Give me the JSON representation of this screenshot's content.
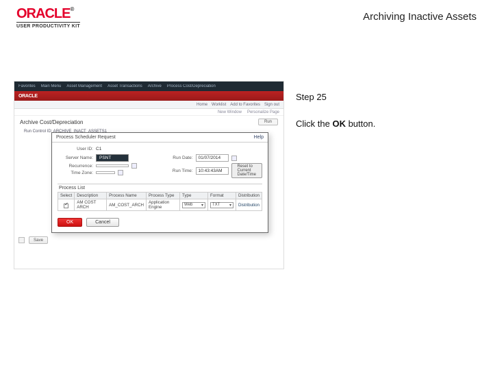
{
  "header": {
    "logo_text": "ORACLE",
    "logo_tm": "®",
    "subline": "USER PRODUCTIVITY KIT",
    "page_title": "Archiving Inactive Assets"
  },
  "instructions": {
    "step_label": "Step 25",
    "body_pre": "Click the ",
    "body_bold": "OK",
    "body_post": " button."
  },
  "screenshot": {
    "topstrip": {
      "items": [
        "Favorites",
        "Main Menu",
        "Asset Management",
        "Asset Transactions",
        "Archive",
        "Process Cost/Depreciation"
      ]
    },
    "brand": "ORACLE",
    "subbar": {
      "items": [
        "Home",
        "Worklist",
        "Add to Favorites",
        "Sign out"
      ]
    },
    "breadcrumb": {
      "items": [
        "New Window",
        "Personalize Page"
      ]
    },
    "page_header": {
      "title": "Archive Cost/Depreciation",
      "button": "Run"
    },
    "run_control": "Run Control ID:  ARCHIVE_INACT_ASSETS1",
    "modal": {
      "title": "Process Scheduler Request",
      "help": "Help",
      "labels": {
        "user_id": "User ID:",
        "server_name": "Server Name:",
        "recurrence": "Recurrence:",
        "time_zone": "Time Zone:",
        "run_date": "Run Date:",
        "run_time": "Run Time:"
      },
      "values": {
        "user_id": "C1",
        "server_name": "PSNT",
        "recurrence": "",
        "time_zone": "",
        "run_date": "01/07/2014",
        "run_time": "10:43:43AM"
      },
      "tz_button": "Reset to Current Date/Time",
      "process_list": {
        "title": "Process List",
        "headers": [
          "Select",
          "Description",
          "Process Name",
          "Process Type",
          "Type",
          "Format",
          "Distribution"
        ],
        "row": {
          "select": true,
          "description": "AM COST ARCH",
          "process_name": "AM_COST_ARCH",
          "process_type": "Application Engine",
          "type": "Web",
          "format": "TXT",
          "distribution": "Distribution"
        }
      },
      "buttons": {
        "ok": "OK",
        "cancel": "Cancel"
      }
    },
    "behind_footer": {
      "save": "Save"
    }
  }
}
